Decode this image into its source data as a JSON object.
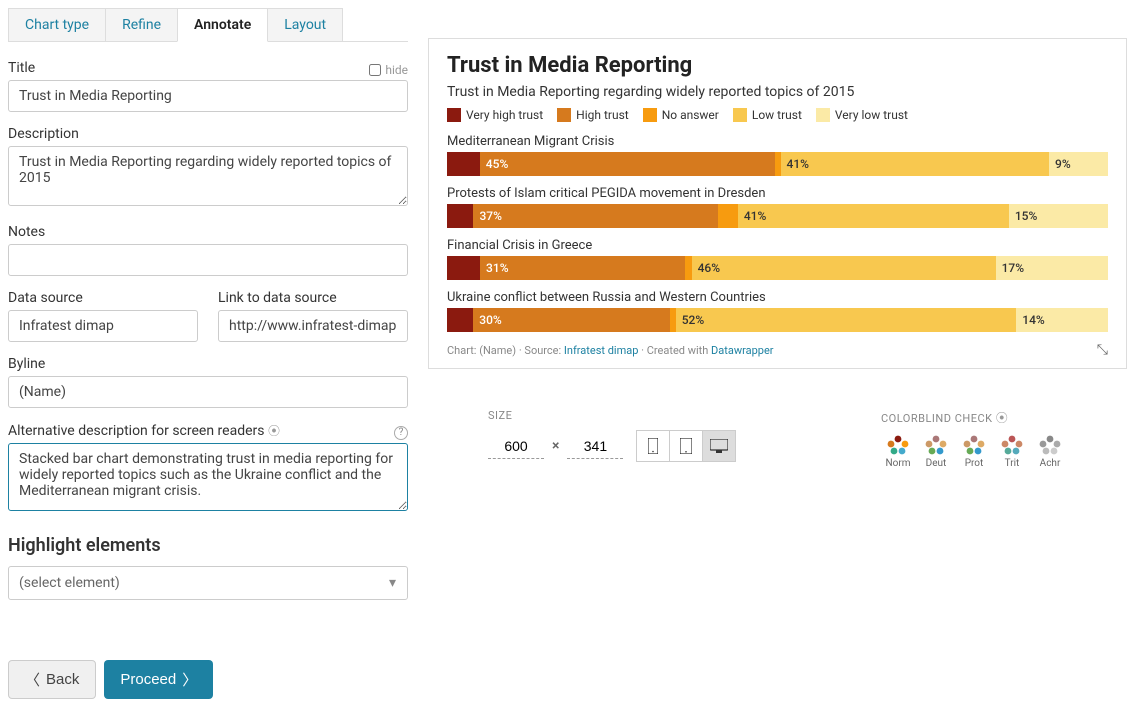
{
  "tabs": {
    "chart_type": "Chart type",
    "refine": "Refine",
    "annotate": "Annotate",
    "layout": "Layout"
  },
  "form": {
    "title_label": "Title",
    "hide_label": "hide",
    "title_value": "Trust in Media Reporting",
    "description_label": "Description",
    "description_value": "Trust in Media Reporting regarding widely reported topics of 2015",
    "notes_label": "Notes",
    "notes_value": "",
    "source_label": "Data source",
    "source_value": "Infratest dimap",
    "link_label": "Link to data source",
    "link_value": "http://www.infratest-dimap.",
    "byline_label": "Byline",
    "byline_value": "(Name)",
    "altdesc_label": "Alternative description for screen readers",
    "altdesc_value": "Stacked bar chart demonstrating trust in media reporting for widely reported topics such as the Ukraine conflict and the Mediterranean migrant crisis. "
  },
  "highlight": {
    "heading": "Highlight elements",
    "placeholder": "(select element)"
  },
  "buttons": {
    "back": "Back",
    "proceed": "Proceed"
  },
  "chart_data": {
    "type": "bar",
    "title": "Trust in Media Reporting",
    "subtitle": "Trust in Media Reporting regarding widely reported topics of 2015",
    "legend": [
      "Very high trust",
      "High trust",
      "No answer",
      "Low trust",
      "Very low trust"
    ],
    "colors": [
      "#8b1a0f",
      "#d67a1e",
      "#f79b0f",
      "#f8c84f",
      "#fbeaa6"
    ],
    "categories": [
      "Mediterranean Migrant Crisis",
      "Protests of Islam critical PEGIDA movement in Dresden",
      "Financial Crisis in Greece",
      "Ukraine conflict between Russia and Western Countries"
    ],
    "series": [
      {
        "name": "Very high trust",
        "values": [
          5,
          4,
          5,
          4
        ]
      },
      {
        "name": "High trust",
        "values": [
          45,
          37,
          31,
          30
        ]
      },
      {
        "name": "No answer",
        "values": [
          0,
          3,
          1,
          0
        ]
      },
      {
        "name": "Low trust",
        "values": [
          41,
          41,
          46,
          52
        ]
      },
      {
        "name": "Very low trust",
        "values": [
          9,
          15,
          17,
          14
        ]
      }
    ],
    "footer": {
      "chart_prefix": "Chart: (Name) · Source: ",
      "source": "Infratest dimap",
      "mid": " · Created with ",
      "dw": "Datawrapper"
    }
  },
  "controls": {
    "size_label": "SIZE",
    "width": "600",
    "height": "341",
    "cb_label": "COLORBLIND CHECK",
    "cb_modes": [
      "Norm",
      "Deut",
      "Prot",
      "Trit",
      "Achr"
    ]
  }
}
